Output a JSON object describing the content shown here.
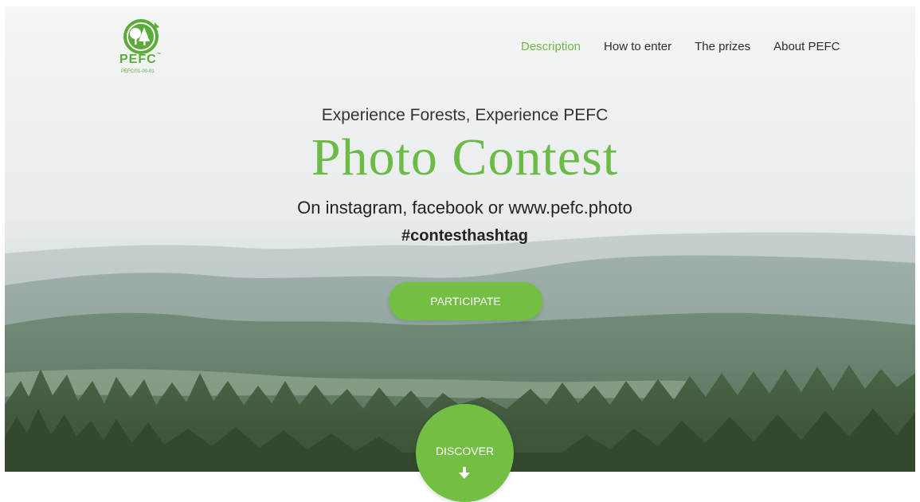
{
  "logo": {
    "name": "PEFC",
    "tm": "™",
    "code": "PEFC/01-00-01",
    "icon": "pefc-trees-logo-icon"
  },
  "nav": {
    "items": [
      {
        "label": "Description",
        "active": true
      },
      {
        "label": "How to enter",
        "active": false
      },
      {
        "label": "The prizes",
        "active": false
      },
      {
        "label": "About PEFC",
        "active": false
      }
    ]
  },
  "hero": {
    "subtitle": "Experience Forests, Experience PEFC",
    "title": "Photo Contest",
    "tagline": "On instagram, facebook or www.pefc.photo",
    "hashtag": "#contesthashtag",
    "participate_label": "PARTICIPATE",
    "discover_label": "DISCOVER",
    "discover_icon": "arrow-down-icon"
  },
  "colors": {
    "brand_green": "#72bf44",
    "title_green": "#6cbb47",
    "active_nav": "#6dba46",
    "text_dark": "#2c2c2c"
  }
}
